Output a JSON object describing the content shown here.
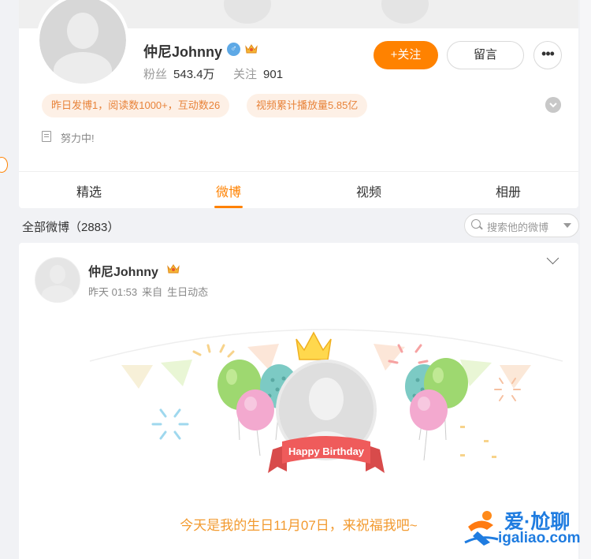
{
  "profile": {
    "name": "仲尼Johnny",
    "gender_icon": "male-icon",
    "fans_label": "粉丝",
    "fans_value": "543.4万",
    "following_label": "关注",
    "following_value": "901",
    "follow_button": "+关注",
    "message_button": "留言",
    "more_button": "•••",
    "tags": [
      "昨日发博1，阅读数1000+，互动数26",
      "视频累计播放量5.85亿"
    ],
    "bio": "努力中!"
  },
  "tabs": [
    {
      "label": "精选",
      "active": false
    },
    {
      "label": "微博",
      "active": true
    },
    {
      "label": "视频",
      "active": false
    },
    {
      "label": "相册",
      "active": false
    }
  ],
  "list": {
    "header": "全部微博（2883）",
    "search_placeholder": "搜索他的微博"
  },
  "post": {
    "author": "仲尼Johnny",
    "time": "昨天 01:53",
    "source_prefix": "来自",
    "source": "生日动态",
    "banner_text": "Happy Birthday",
    "text": "今天是我的生日11月07日，来祝福我吧~"
  },
  "watermark": {
    "line1": "爱·尬聊",
    "line2": "igaliao.com"
  },
  "colors": {
    "accent": "#ff8200",
    "tag_bg": "#fdf0e6",
    "tag_text": "#e8833a",
    "birthday_text": "#f29a2f"
  }
}
